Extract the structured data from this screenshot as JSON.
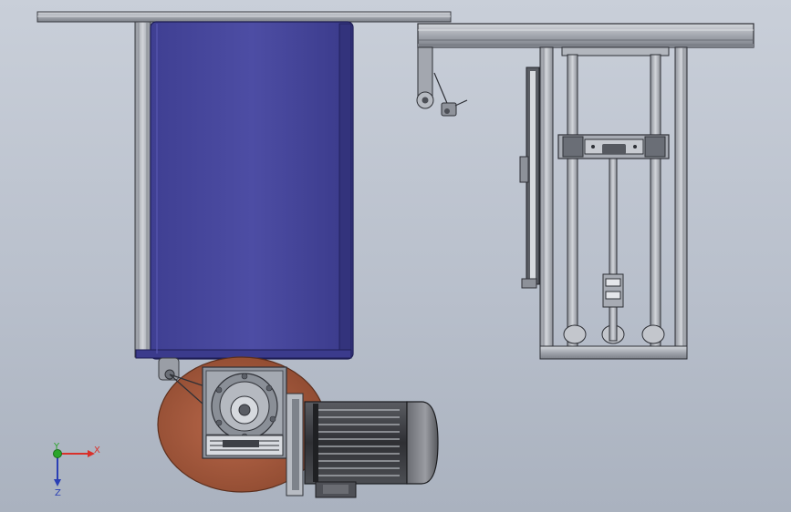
{
  "viewport": {
    "background": "#bcc3cf"
  },
  "triad": {
    "x_label": "X",
    "y_label": "Y",
    "z_label": "Z",
    "x_color": "#d9302a",
    "y_color": "#2aa52a",
    "z_color": "#2a3fb5"
  },
  "colors": {
    "frame_steel": "#a9adb6",
    "panel_blue": "#4a4a9e",
    "wheel_copper": "#a65a3a",
    "motor_dark": "#3c3e43",
    "gearbox_grey": "#8e939c"
  }
}
